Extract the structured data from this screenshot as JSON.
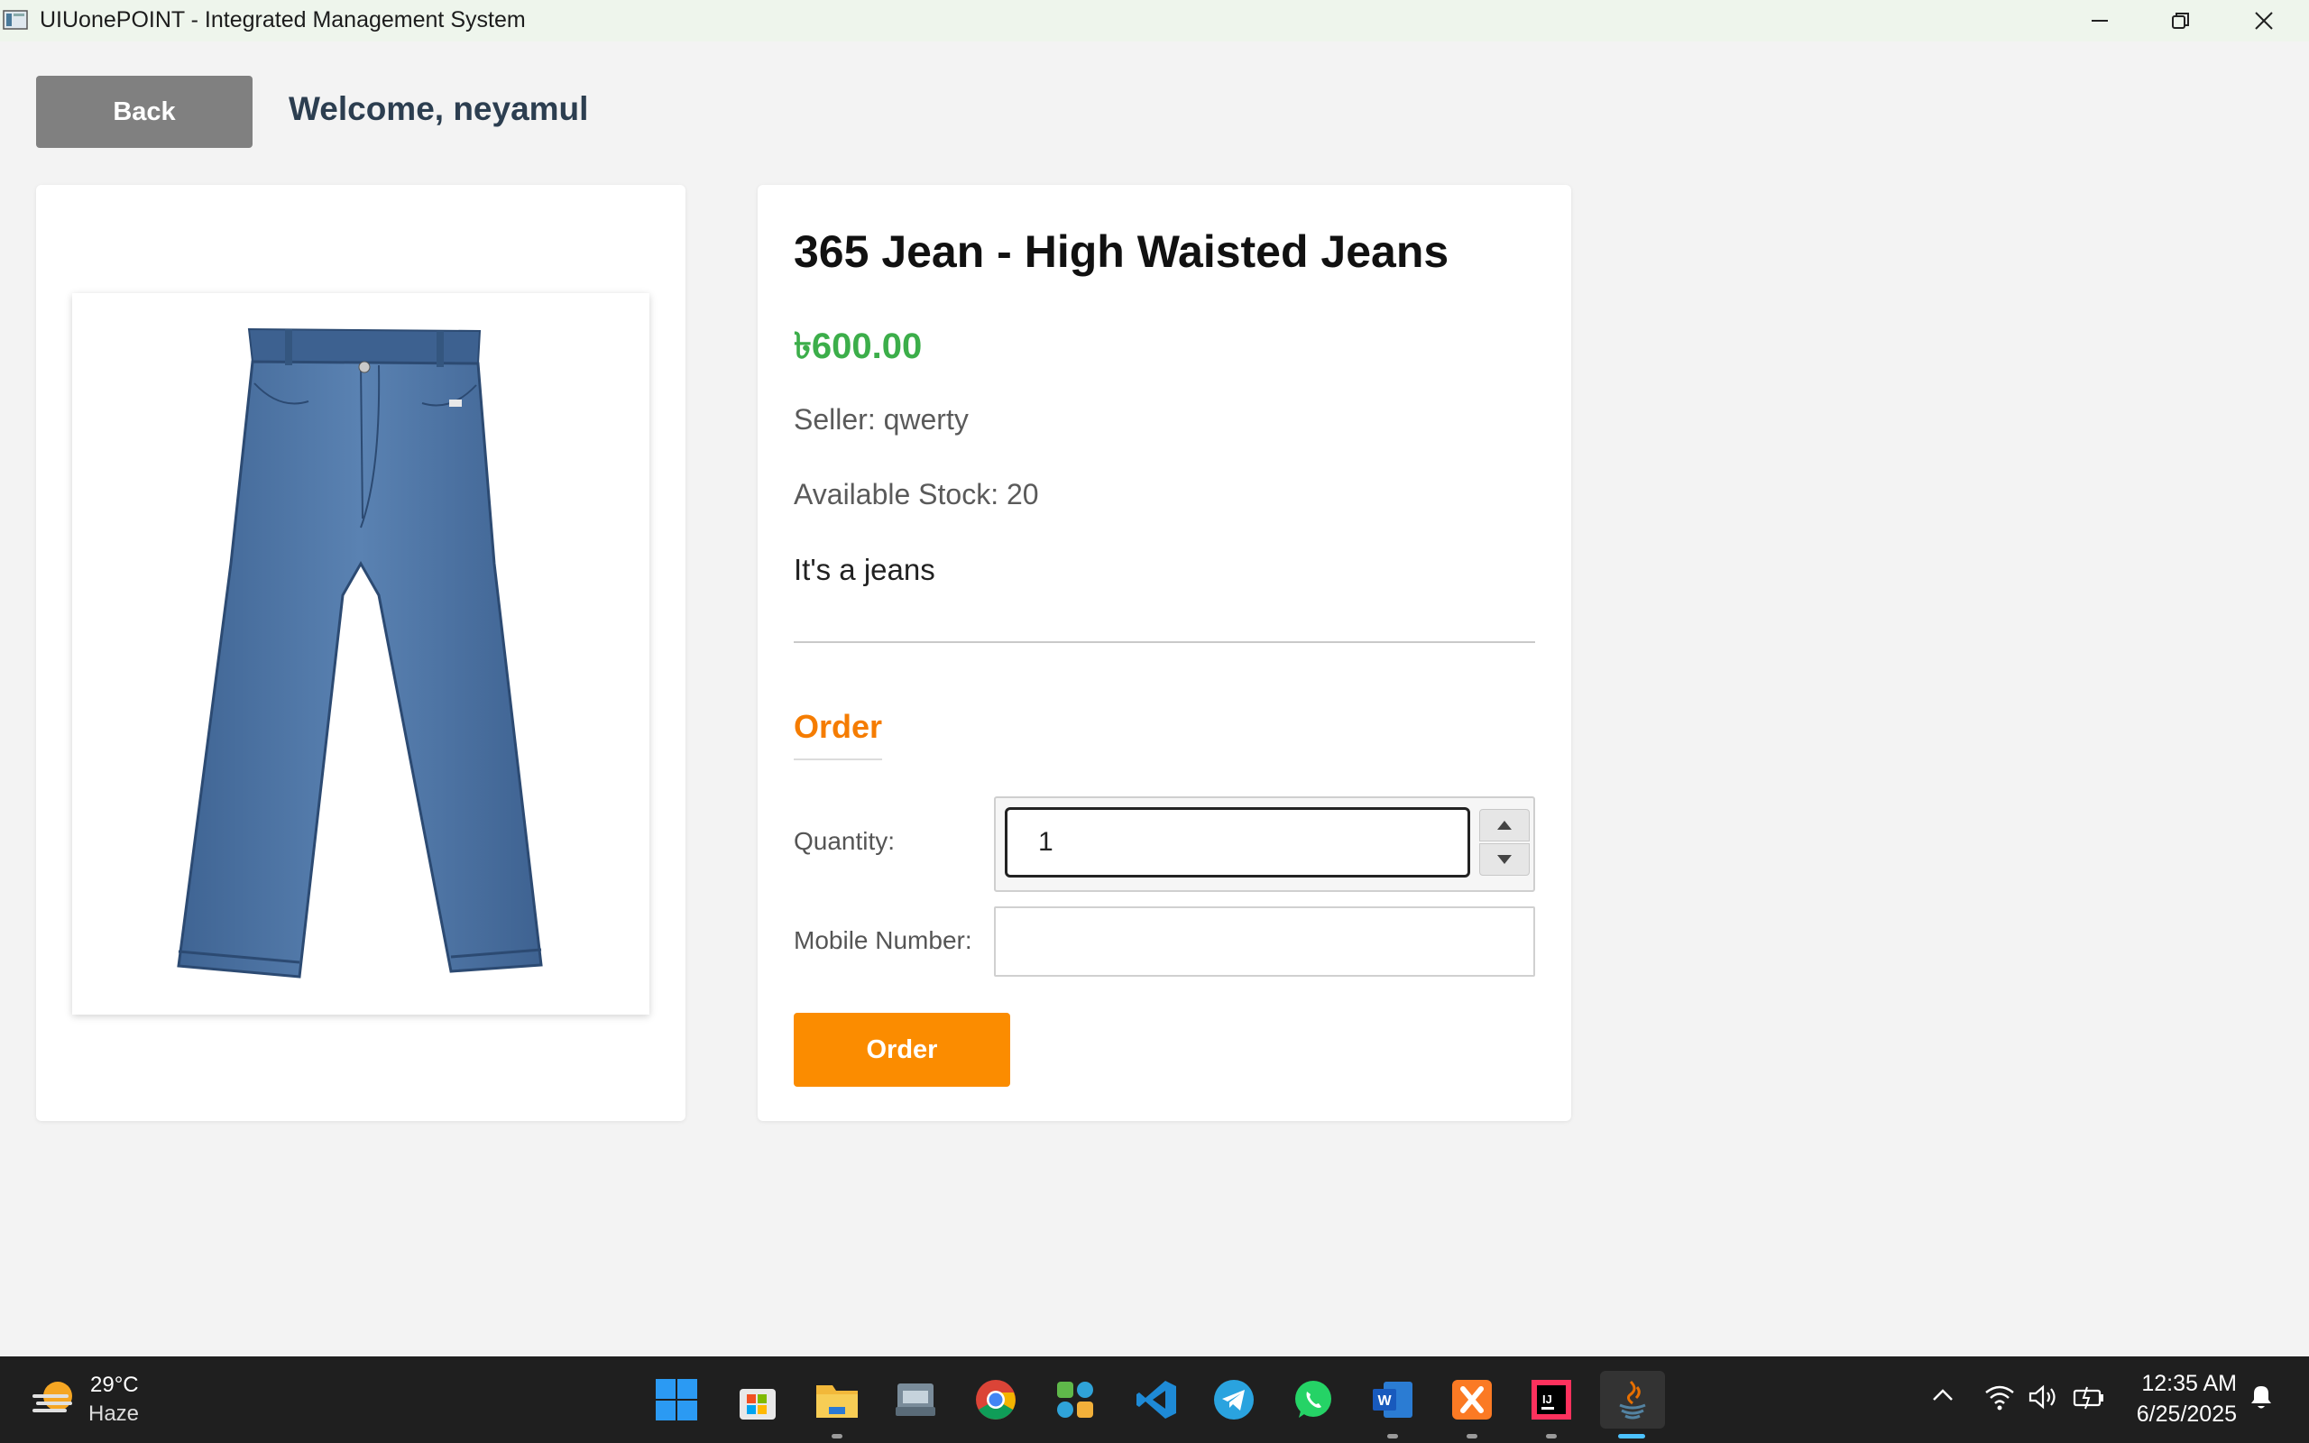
{
  "window": {
    "title": "UIUonePOINT - Integrated Management System"
  },
  "header": {
    "back_label": "Back",
    "welcome_text": "Welcome, neyamul"
  },
  "product": {
    "name": "365 Jean - High Waisted Jeans",
    "price": "৳600.00",
    "seller": "Seller: qwerty",
    "stock": "Available Stock: 20",
    "description": "It's a jeans",
    "image_icon": "jeans-image"
  },
  "order": {
    "heading": "Order",
    "quantity_label": "Quantity:",
    "quantity_value": "1",
    "mobile_label": "Mobile Number:",
    "mobile_value": "",
    "submit_label": "Order"
  },
  "colors": {
    "price": "#3cae4a",
    "accent": "#fb8c00",
    "back_button": "#808080",
    "heading": "#2c3e50"
  },
  "taskbar": {
    "weather_temp": "29°C",
    "weather_desc": "Haze",
    "apps": [
      "start-icon",
      "store-icon",
      "file-explorer-icon",
      "keyboard-app-icon",
      "chrome-icon",
      "app-icon",
      "vscode-icon",
      "telegram-icon",
      "whatsapp-icon",
      "word-icon",
      "xampp-icon",
      "intellij-icon",
      "java-icon"
    ],
    "time": "12:35 AM",
    "date": "6/25/2025"
  }
}
